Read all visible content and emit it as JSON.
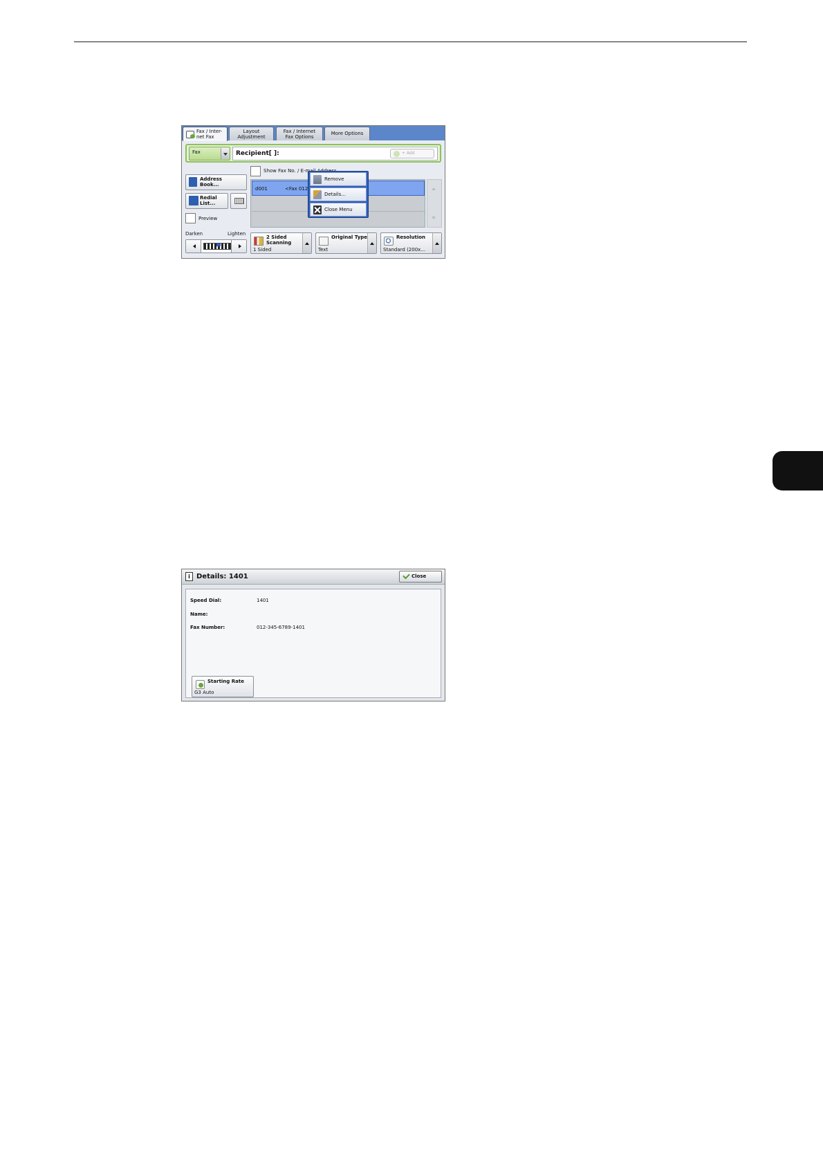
{
  "screen1": {
    "tabs": [
      {
        "label": "Fax / Inter-\nnet Fax"
      },
      {
        "label": "Layout\nAdjustment"
      },
      {
        "label": "Fax / Internet\nFax Options"
      },
      {
        "label": "More Options"
      }
    ],
    "fax_type": "Fax",
    "recipient_label": "Recipient[    ]:",
    "add_label": "+ Add",
    "show_fax_label": "Show Fax No. / E-mail Address",
    "address_book_label": "Address\nBook...",
    "redial_label": "Redial\nList...",
    "preview_label": "Preview",
    "list": {
      "selected_id": "d001",
      "selected_value": "<Fax 012"
    },
    "context_menu": {
      "remove": "Remove",
      "details": "Details...",
      "close_menu": "Close Menu"
    },
    "darken_label": "Darken",
    "lighten_label": "Lighten",
    "density_level": 0.55,
    "features": [
      {
        "title": "2 Sided\nScanning",
        "value": "1 Sided"
      },
      {
        "title": "Original Type",
        "value": "Text"
      },
      {
        "title": "Resolution",
        "value": "Standard (200x..."
      }
    ]
  },
  "screen2": {
    "title": "Details: 1401",
    "close_label": "Close",
    "speed_dial_label": "Speed Dial:",
    "speed_dial_value": "1401",
    "name_label": "Name:",
    "name_value": "",
    "fax_number_label": "Fax Number:",
    "fax_number_value": "012-345-6789-1401",
    "starting_rate_label": "Starting Rate",
    "starting_rate_value": "G3 Auto"
  },
  "colors": {
    "tab_bar": "#5b86c9",
    "selection": "#7fa5f0",
    "popup_frame": "#2f5fb8",
    "recipient_frame": "#8cc257"
  }
}
